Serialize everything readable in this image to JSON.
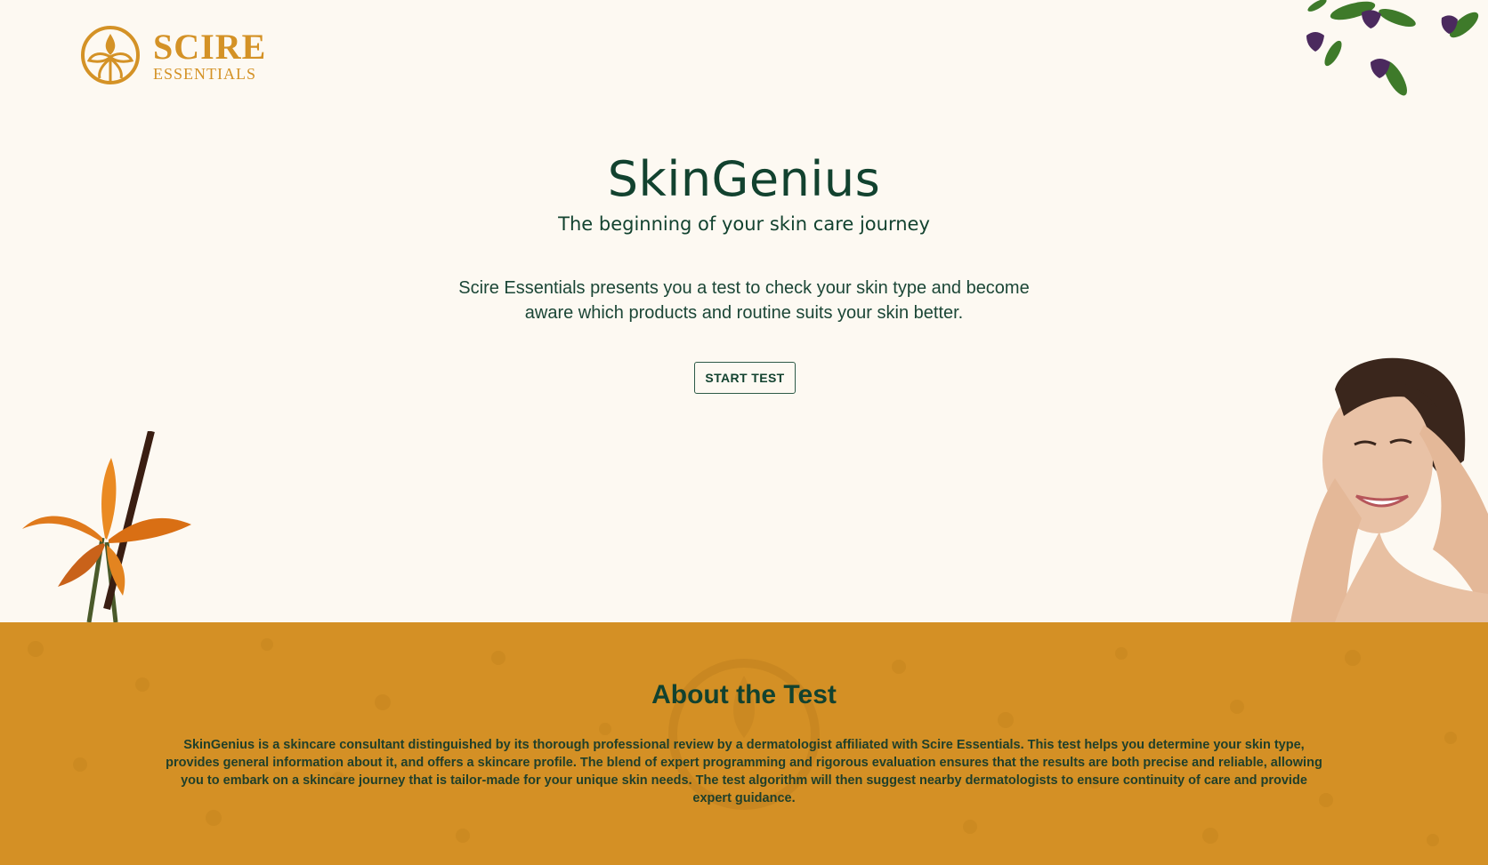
{
  "brand": {
    "name": "SCIRE",
    "sub": "ESSENTIALS",
    "color": "#d49226"
  },
  "hero": {
    "title": "SkinGenius",
    "subtitle": "The beginning of your skin care journey",
    "intro": "Scire Essentials presents you a test to check your skin type and become aware which products and routine suits your skin better.",
    "start_label": "START TEST"
  },
  "about": {
    "title": "About the Test",
    "text": "SkinGenius is a skincare consultant distinguished by its thorough professional review by a dermatologist affiliated with Scire Essentials. This test helps you determine your skin type, provides general information about it, and offers a skincare profile. The blend of expert programming and rigorous evaluation ensures that the results are both precise and reliable, allowing you to embark on a skincare journey that is tailor-made for your unique skin needs. The test algorithm will then suggest nearby dermatologists to ensure continuity of care and provide expert guidance.",
    "background_color": "#d49025"
  },
  "colors": {
    "page_bg": "#fdf9f2",
    "text_dark_green": "#12422f"
  },
  "icons": [
    "scire-logo-icon",
    "violet-flowers-image",
    "lily-flower-image",
    "woman-portrait-image"
  ]
}
